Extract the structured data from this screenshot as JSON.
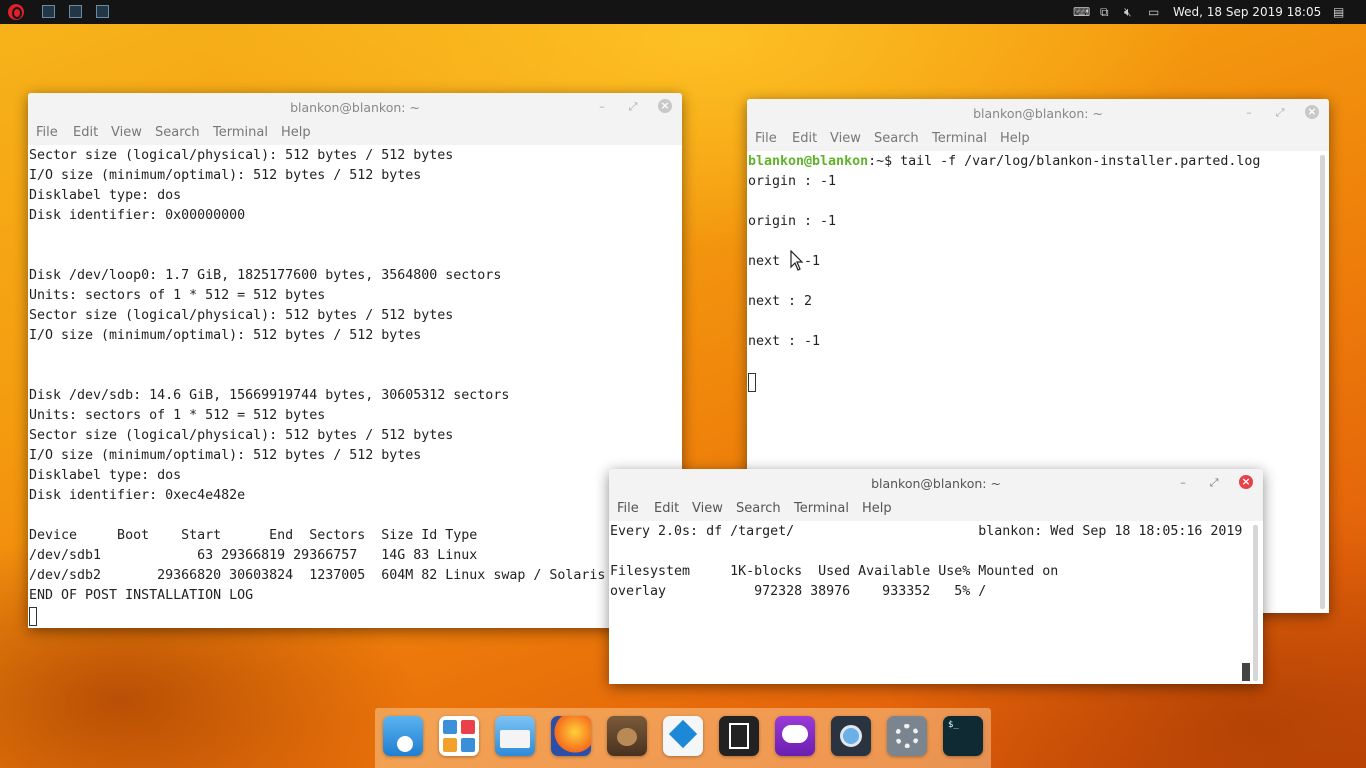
{
  "topbar": {
    "clock": "Wed, 18 Sep 2019 18:05"
  },
  "windows": {
    "left": {
      "title": "blankon@blankon: ~",
      "menu": [
        "File",
        "Edit",
        "View",
        "Search",
        "Terminal",
        "Help"
      ],
      "lines": [
        "Sector size (logical/physical): 512 bytes / 512 bytes",
        "I/O size (minimum/optimal): 512 bytes / 512 bytes",
        "Disklabel type: dos",
        "Disk identifier: 0x00000000",
        "",
        "",
        "Disk /dev/loop0: 1.7 GiB, 1825177600 bytes, 3564800 sectors",
        "Units: sectors of 1 * 512 = 512 bytes",
        "Sector size (logical/physical): 512 bytes / 512 bytes",
        "I/O size (minimum/optimal): 512 bytes / 512 bytes",
        "",
        "",
        "Disk /dev/sdb: 14.6 GiB, 15669919744 bytes, 30605312 sectors",
        "Units: sectors of 1 * 512 = 512 bytes",
        "Sector size (logical/physical): 512 bytes / 512 bytes",
        "I/O size (minimum/optimal): 512 bytes / 512 bytes",
        "Disklabel type: dos",
        "Disk identifier: 0xec4e482e",
        "",
        "Device     Boot    Start      End  Sectors  Size Id Type",
        "/dev/sdb1            63 29366819 29366757   14G 83 Linux",
        "/dev/sdb2       29366820 30603824  1237005  604M 82 Linux swap / Solaris",
        "END OF POST INSTALLATION LOG"
      ]
    },
    "right": {
      "title": "blankon@blankon: ~",
      "menu": [
        "File",
        "Edit",
        "View",
        "Search",
        "Terminal",
        "Help"
      ],
      "prompt_user": "blankon@blankon",
      "prompt_rest": ":~$ tail -f /var/log/blankon-installer.parted.log",
      "lines": [
        "origin : -1",
        "",
        "origin : -1",
        "",
        "next : -1",
        "",
        "next : 2",
        "",
        "next : -1"
      ]
    },
    "bottom": {
      "title": "blankon@blankon: ~",
      "menu": [
        "File",
        "Edit",
        "View",
        "Search",
        "Terminal",
        "Help"
      ],
      "lines": [
        "Every 2.0s: df /target/                       blankon: Wed Sep 18 18:05:16 2019",
        "",
        "Filesystem     1K-blocks  Used Available Use% Mounted on",
        "overlay           972328 38976    933352   5% /"
      ]
    }
  },
  "dock": {
    "apps": [
      "app-store-icon",
      "calculator-icon",
      "files-icon",
      "firefox-icon",
      "gimp-icon",
      "inkscape-icon",
      "document-viewer-icon",
      "chat-icon",
      "webcam-icon",
      "settings-icon",
      "terminal-icon"
    ]
  }
}
